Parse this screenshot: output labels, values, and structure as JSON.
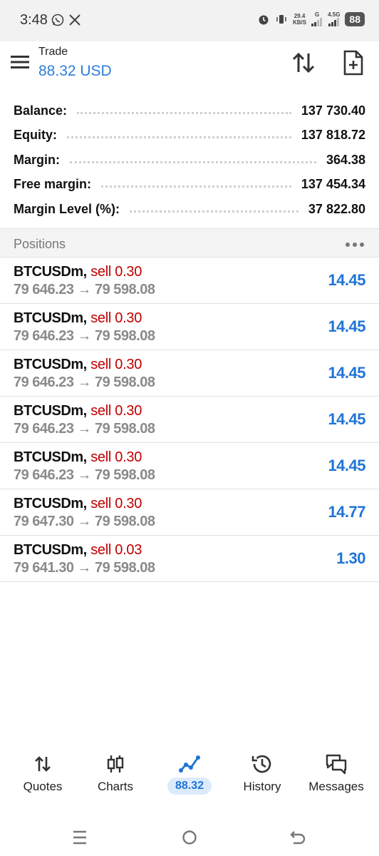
{
  "status_bar": {
    "time": "3:48",
    "net_speed_value": "29.4",
    "net_speed_unit": "KB/S",
    "signal1_label": "G",
    "signal2_label": "4.5G",
    "battery": "88"
  },
  "header": {
    "title": "Trade",
    "subtitle": "88.32 USD",
    "accent_color": "#2d7ddb"
  },
  "summary": [
    {
      "label": "Balance:",
      "value": "137 730.40"
    },
    {
      "label": "Equity:",
      "value": "137 818.72"
    },
    {
      "label": "Margin:",
      "value": "364.38"
    },
    {
      "label": "Free margin:",
      "value": "137 454.34"
    },
    {
      "label": "Margin Level (%):",
      "value": "37 822.80"
    }
  ],
  "positions": {
    "title": "Positions",
    "sell_color": "#c00000",
    "profit_color": "#1f74d6",
    "rows": [
      {
        "symbol": "BTCUSDm,",
        "side": "sell 0.30",
        "open": "79 646.23",
        "arrow": "→",
        "current": "79 598.08",
        "profit": "14.45"
      },
      {
        "symbol": "BTCUSDm,",
        "side": "sell 0.30",
        "open": "79 646.23",
        "arrow": "→",
        "current": "79 598.08",
        "profit": "14.45"
      },
      {
        "symbol": "BTCUSDm,",
        "side": "sell 0.30",
        "open": "79 646.23",
        "arrow": "→",
        "current": "79 598.08",
        "profit": "14.45"
      },
      {
        "symbol": "BTCUSDm,",
        "side": "sell 0.30",
        "open": "79 646.23",
        "arrow": "→",
        "current": "79 598.08",
        "profit": "14.45"
      },
      {
        "symbol": "BTCUSDm,",
        "side": "sell 0.30",
        "open": "79 646.23",
        "arrow": "→",
        "current": "79 598.08",
        "profit": "14.45"
      },
      {
        "symbol": "BTCUSDm,",
        "side": "sell 0.30",
        "open": "79 647.30",
        "arrow": "→",
        "current": "79 598.08",
        "profit": "14.77"
      },
      {
        "symbol": "BTCUSDm,",
        "side": "sell 0.03",
        "open": "79 641.30",
        "arrow": "→",
        "current": "79 598.08",
        "profit": "1.30"
      }
    ]
  },
  "bottom_nav": [
    {
      "label": "Quotes",
      "icon": "quotes-arrows-icon"
    },
    {
      "label": "Charts",
      "icon": "candlestick-icon"
    },
    {
      "label": "88.32",
      "icon": "trade-line-icon",
      "active": true
    },
    {
      "label": "History",
      "icon": "history-clock-icon"
    },
    {
      "label": "Messages",
      "icon": "messages-icon"
    }
  ]
}
